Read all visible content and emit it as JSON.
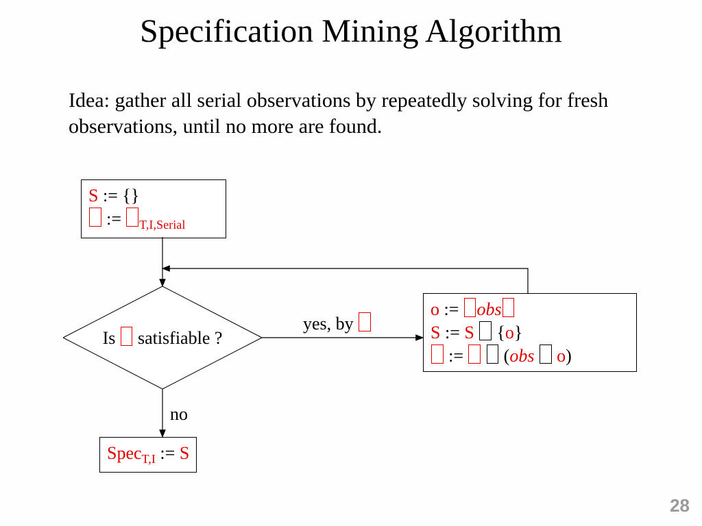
{
  "title": "Specification Mining Algorithm",
  "idea": "Idea: gather all serial observations by repeatedly solving for fresh observations, until no more are found.",
  "init": {
    "s_var": "S",
    "assign": " := ",
    "s_val": "{}",
    "phi_sub": "T,I,Serial"
  },
  "decision": {
    "prefix": "Is ",
    "suffix": " satisfiable ?"
  },
  "edge_yes": "yes, by ",
  "edge_no": "no",
  "update": {
    "o_var": "o",
    "assign": " := ",
    "obs": "obs",
    "s_var": "S",
    "union_open": " {",
    "union_close": "}",
    "paren_open": " (",
    "paren_close": ")",
    "neq": " ",
    "o_ref": "o"
  },
  "result": {
    "spec": "Spec",
    "sub": "T,I",
    "assign": " := ",
    "val": "S"
  },
  "pagenum": "28"
}
